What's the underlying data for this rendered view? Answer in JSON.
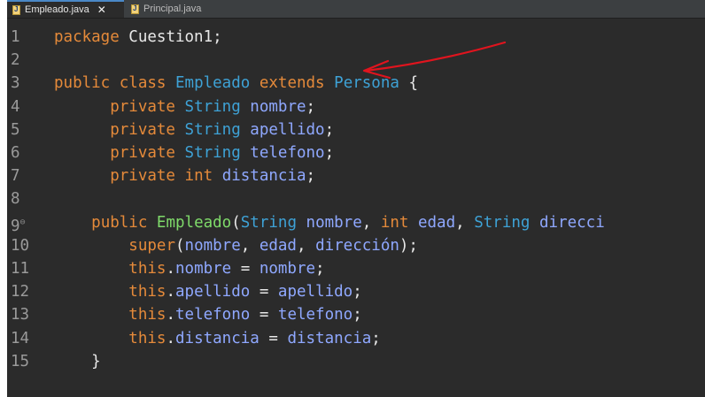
{
  "tabs": [
    {
      "label": "Empleado.java",
      "active": true,
      "close": "✕"
    },
    {
      "label": "Principal.java",
      "active": false
    }
  ],
  "lines": [
    {
      "n": "1",
      "tokens": [
        [
          "kw",
          "package"
        ],
        [
          "pl",
          " Cuestion1;"
        ]
      ]
    },
    {
      "n": "2",
      "tokens": []
    },
    {
      "n": "3",
      "tokens": [
        [
          "kw",
          "public"
        ],
        [
          "pl",
          " "
        ],
        [
          "kw",
          "class"
        ],
        [
          "pl",
          " "
        ],
        [
          "ty",
          "Empleado"
        ],
        [
          "pl",
          " "
        ],
        [
          "kw",
          "extends"
        ],
        [
          "pl",
          " "
        ],
        [
          "ty",
          "Persona"
        ],
        [
          "pl",
          " {"
        ]
      ]
    },
    {
      "n": "4",
      "tokens": [
        [
          "pl",
          "      "
        ],
        [
          "kw",
          "private"
        ],
        [
          "pl",
          " "
        ],
        [
          "ty",
          "String"
        ],
        [
          "pl",
          " "
        ],
        [
          "fd",
          "nombre"
        ],
        [
          "pl",
          ";"
        ]
      ]
    },
    {
      "n": "5",
      "tokens": [
        [
          "pl",
          "      "
        ],
        [
          "kw",
          "private"
        ],
        [
          "pl",
          " "
        ],
        [
          "ty",
          "String"
        ],
        [
          "pl",
          " "
        ],
        [
          "fd",
          "apellido"
        ],
        [
          "pl",
          ";"
        ]
      ]
    },
    {
      "n": "6",
      "tokens": [
        [
          "pl",
          "      "
        ],
        [
          "kw",
          "private"
        ],
        [
          "pl",
          " "
        ],
        [
          "ty",
          "String"
        ],
        [
          "pl",
          " "
        ],
        [
          "fd",
          "telefono"
        ],
        [
          "pl",
          ";"
        ]
      ]
    },
    {
      "n": "7",
      "tokens": [
        [
          "pl",
          "      "
        ],
        [
          "kw",
          "private"
        ],
        [
          "pl",
          " "
        ],
        [
          "kw",
          "int"
        ],
        [
          "pl",
          " "
        ],
        [
          "fd",
          "distancia"
        ],
        [
          "pl",
          ";"
        ]
      ]
    },
    {
      "n": "8",
      "tokens": []
    },
    {
      "n": "9",
      "fold": "⊖",
      "tokens": [
        [
          "pl",
          "    "
        ],
        [
          "kw",
          "public"
        ],
        [
          "pl",
          " "
        ],
        [
          "ct",
          "Empleado"
        ],
        [
          "pl",
          "("
        ],
        [
          "ty",
          "String"
        ],
        [
          "pl",
          " "
        ],
        [
          "fd",
          "nombre"
        ],
        [
          "pl",
          ", "
        ],
        [
          "kw",
          "int"
        ],
        [
          "pl",
          " "
        ],
        [
          "fd",
          "edad"
        ],
        [
          "pl",
          ", "
        ],
        [
          "ty",
          "String"
        ],
        [
          "pl",
          " "
        ],
        [
          "fd",
          "direcci"
        ]
      ]
    },
    {
      "n": "10",
      "tokens": [
        [
          "pl",
          "        "
        ],
        [
          "kw",
          "super"
        ],
        [
          "pl",
          "("
        ],
        [
          "fd",
          "nombre"
        ],
        [
          "pl",
          ", "
        ],
        [
          "fd",
          "edad"
        ],
        [
          "pl",
          ", "
        ],
        [
          "fd",
          "dirección"
        ],
        [
          "pl",
          ");"
        ]
      ]
    },
    {
      "n": "11",
      "tokens": [
        [
          "pl",
          "        "
        ],
        [
          "kw",
          "this"
        ],
        [
          "pl",
          "."
        ],
        [
          "fd",
          "nombre"
        ],
        [
          "pl",
          " = "
        ],
        [
          "fd",
          "nombre"
        ],
        [
          "pl",
          ";"
        ]
      ]
    },
    {
      "n": "12",
      "tokens": [
        [
          "pl",
          "        "
        ],
        [
          "kw",
          "this"
        ],
        [
          "pl",
          "."
        ],
        [
          "fd",
          "apellido"
        ],
        [
          "pl",
          " = "
        ],
        [
          "fd",
          "apellido"
        ],
        [
          "pl",
          ";"
        ]
      ]
    },
    {
      "n": "13",
      "tokens": [
        [
          "pl",
          "        "
        ],
        [
          "kw",
          "this"
        ],
        [
          "pl",
          "."
        ],
        [
          "fd",
          "telefono"
        ],
        [
          "pl",
          " = "
        ],
        [
          "fd",
          "telefono"
        ],
        [
          "pl",
          ";"
        ]
      ]
    },
    {
      "n": "14",
      "tokens": [
        [
          "pl",
          "        "
        ],
        [
          "kw",
          "this"
        ],
        [
          "pl",
          "."
        ],
        [
          "fd",
          "distancia"
        ],
        [
          "pl",
          " = "
        ],
        [
          "fd",
          "distancia"
        ],
        [
          "pl",
          ";"
        ]
      ]
    },
    {
      "n": "15",
      "tokens": [
        [
          "pl",
          "    }"
        ]
      ]
    }
  ],
  "colors": {
    "editor_bg": "#2b2b2b",
    "keyword": "#e58a3a",
    "type": "#3ea2d6",
    "field": "#8fa8ff",
    "constructor": "#7fdb6a",
    "annotation_arrow": "#e0141e"
  },
  "annotation": "red-hand-drawn-arrow"
}
